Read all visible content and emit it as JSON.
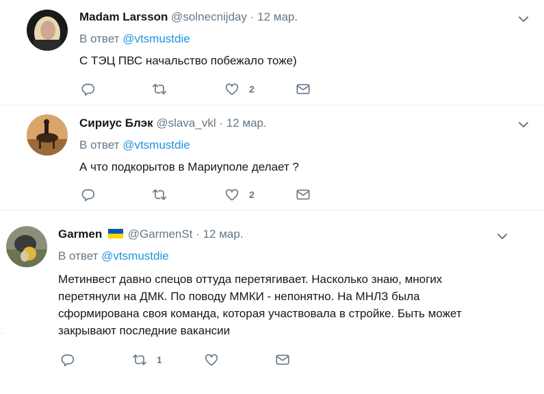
{
  "reply_prefix": "В ответ",
  "tweets": [
    {
      "name": "Madam Larsson",
      "handle": "@solnecnijday",
      "date": "12 мар.",
      "reply_to": "@vtsmustdie",
      "text": "С ТЭЦ ПВС начальство побежало тоже)",
      "retweets": "",
      "likes": "2"
    },
    {
      "name": "Сириус Блэк",
      "handle": "@slava_vkl",
      "date": "12 мар.",
      "reply_to": "@vtsmustdie",
      "text": "А что подкорытов в Мариуполе делает ?",
      "retweets": "",
      "likes": "2"
    },
    {
      "name": "Garmen",
      "handle": "@GarmenSt",
      "date": "12 мар.",
      "reply_to": "@vtsmustdie",
      "text_lines": [
        "Метинвест давно спецов оттуда перетягивает. Насколько знаю, многих",
        "перетянули на ДМК. По поводу ММКИ - непонятно. На МНЛЗ была",
        "сформирована своя команда, которая участвовала в стройке. Быть может",
        "закрывают последние вакансии"
      ],
      "retweets": "1",
      "likes": ""
    }
  ],
  "colors": {
    "link": "#1b95e0",
    "muted": "#657786",
    "text": "#14171a",
    "divider": "#e6ecf0",
    "flag_blue": "#0057b7",
    "flag_yellow": "#ffd700"
  }
}
